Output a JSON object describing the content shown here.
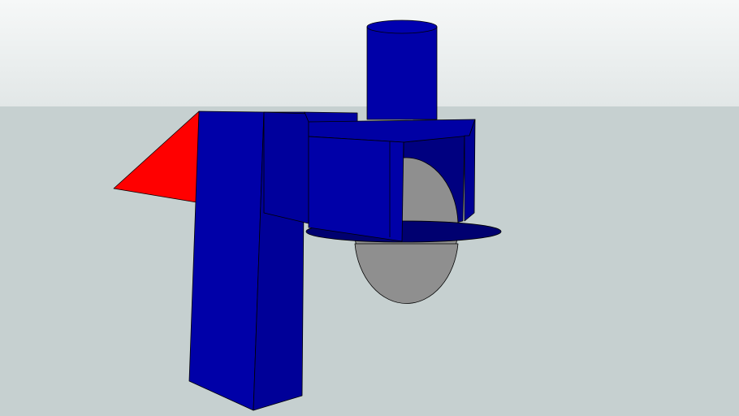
{
  "scene": {
    "colors": {
      "sky_top": "#f4f6f6",
      "sky_bottom": "#e3e8e8",
      "ground": "#c6d0d0",
      "blue_front": "#0000a8",
      "blue_side": "#000090",
      "blue_dark": "#000070",
      "red": "#ff0000",
      "gray": "#8f8f8f",
      "edge": "#000000"
    }
  }
}
